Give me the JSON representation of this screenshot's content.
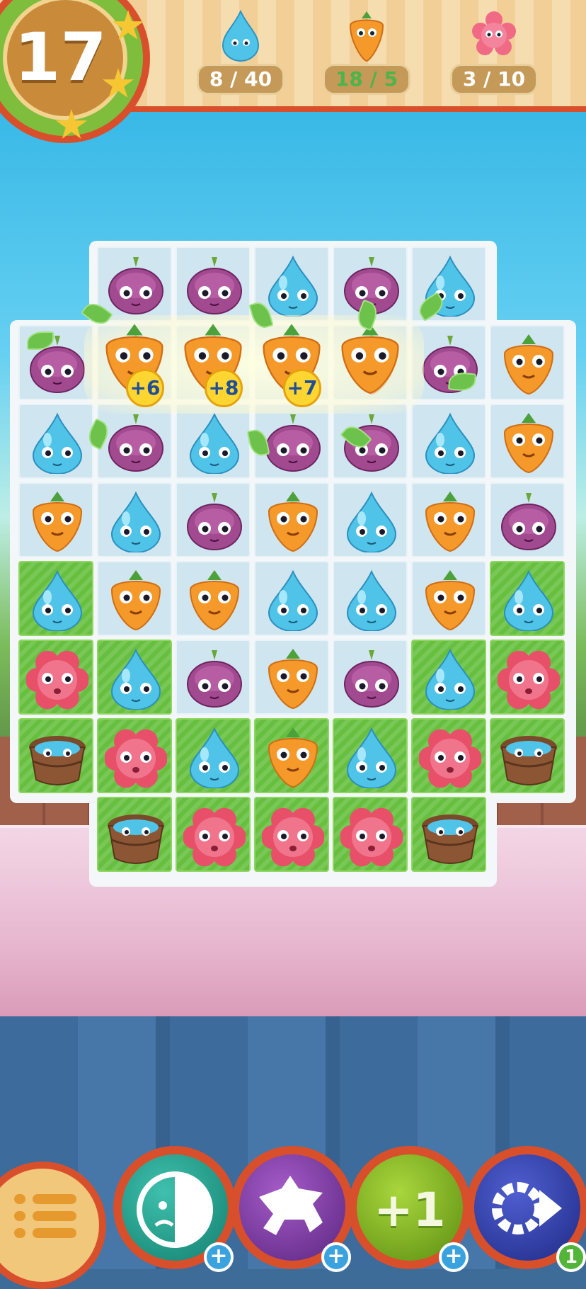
{
  "hud": {
    "moves_left": "17",
    "stars_earned": 3,
    "goals": [
      {
        "icon": "water-drop-icon",
        "label": "8 / 40",
        "done": false
      },
      {
        "icon": "carrot-icon",
        "label": "18 / 5",
        "done": true
      },
      {
        "icon": "flower-icon",
        "label": "3 / 10",
        "done": false
      }
    ]
  },
  "board": {
    "columns": 7,
    "rows": 8,
    "cells": [
      [
        null,
        "onion",
        "onion",
        "water",
        "onion",
        "water",
        null
      ],
      [
        "onion",
        "carrot",
        "carrot",
        "carrot",
        "carrot",
        "onion",
        "carrot"
      ],
      [
        "water",
        "onion",
        "water",
        "onion",
        "onion",
        "water",
        "carrot"
      ],
      [
        "carrot",
        "water",
        "onion",
        "carrot",
        "water",
        "carrot",
        "onion"
      ],
      [
        "water",
        "carrot",
        "carrot",
        "water",
        "water",
        "carrot",
        "water"
      ],
      [
        "flower",
        "water",
        "onion",
        "carrot",
        "onion",
        "water",
        "flower"
      ],
      [
        "bucket",
        "flower",
        "water",
        "carrot",
        "water",
        "flower",
        "bucket"
      ],
      [
        null,
        "bucket",
        "flower",
        "flower",
        "flower",
        "bucket",
        null
      ]
    ],
    "ground": [
      [
        null,
        "ice",
        "ice",
        "ice",
        "ice",
        "ice",
        null
      ],
      [
        "ice",
        "ice",
        "ice",
        "ice",
        "ice",
        "ice",
        "ice"
      ],
      [
        "ice",
        "ice",
        "ice",
        "ice",
        "ice",
        "ice",
        "ice"
      ],
      [
        "ice",
        "ice",
        "ice",
        "ice",
        "ice",
        "ice",
        "ice"
      ],
      [
        "grass",
        "ice",
        "ice",
        "ice",
        "ice",
        "ice",
        "grass"
      ],
      [
        "grass",
        "grass",
        "ice",
        "ice",
        "ice",
        "grass",
        "grass"
      ],
      [
        "grass",
        "grass",
        "grass",
        "grass",
        "grass",
        "grass",
        "grass"
      ],
      [
        null,
        "grass",
        "grass",
        "grass",
        "grass",
        "grass",
        null
      ]
    ],
    "bonuses": [
      "+6",
      "+8",
      "+7"
    ]
  },
  "boosters": [
    {
      "name": "shovel-booster",
      "icon": "shovel-face-icon",
      "badge": "+",
      "color": "#1f9a8a"
    },
    {
      "name": "dog-booster",
      "icon": "dog-icon",
      "badge": "+",
      "color": "#7a3aa0"
    },
    {
      "name": "extra-move-booster",
      "label": "+1",
      "badge": "+",
      "color": "#8bbd23"
    },
    {
      "name": "shuffle-booster",
      "icon": "shuffle-icon",
      "badge": "1",
      "color": "#2f3fa8"
    }
  ],
  "colors": {
    "water": "#4fc4e8",
    "carrot": "#f59a2a",
    "onion": "#a24a8f",
    "flower": "#e8506a",
    "bucket": "#7b4a2a",
    "accent": "#d84f2c"
  }
}
